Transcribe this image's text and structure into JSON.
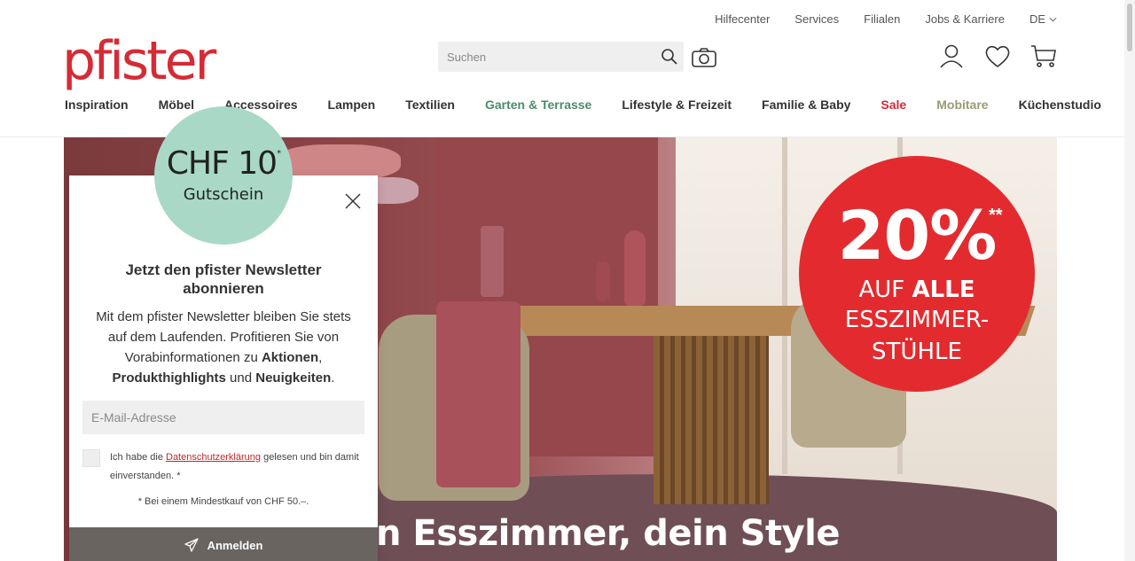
{
  "util_nav": [
    "Hilfecenter",
    "Services",
    "Filialen",
    "Jobs & Karriere"
  ],
  "language": "DE",
  "logo": "pfister",
  "search": {
    "placeholder": "Suchen"
  },
  "main_nav": [
    {
      "label": "Inspiration"
    },
    {
      "label": "Möbel"
    },
    {
      "label": "Accessoires"
    },
    {
      "label": "Lampen"
    },
    {
      "label": "Textilien"
    },
    {
      "label": "Garten & Terrasse",
      "color": "#4a8c6b"
    },
    {
      "label": "Lifestyle & Freizeit"
    },
    {
      "label": "Familie & Baby"
    },
    {
      "label": "Sale",
      "color": "#d52b35"
    },
    {
      "label": "Mobitare",
      "color": "#9a9a74"
    },
    {
      "label": "Küchenstudio"
    }
  ],
  "hero": {
    "headline": "n Esszimmer, dein Style",
    "badge": {
      "percent": "20%",
      "stars": "**",
      "line1_a": "AUF ",
      "line1_b": "ALLE",
      "line2": "ESSZIMMER-",
      "line3": "STÜHLE"
    }
  },
  "newsletter": {
    "voucher_amount": "CHF 10",
    "voucher_sup": "*",
    "voucher_label": "Gutschein",
    "title": "Jetzt den pfister Newsletter abonnieren",
    "desc_1": "Mit dem pfister Newsletter bleiben Sie stets auf dem Laufenden. Profitieren Sie von Vorabinformationen zu ",
    "desc_b1": "Aktionen",
    "desc_2": ", ",
    "desc_b2": "Produkthighlights",
    "desc_3": " und ",
    "desc_b3": "Neuigkeiten",
    "desc_4": ".",
    "email_placeholder": "E-Mail-Adresse",
    "consent_1": "Ich habe die ",
    "consent_link": "Datenschutzerklärung",
    "consent_2": " gelesen und bin damit einverstanden. *",
    "footnote": "* Bei einem Mindestkauf von CHF 50.–.",
    "submit_label": "Anmelden"
  },
  "colors": {
    "brand": "#d52b35",
    "voucher": "#a9d9c6",
    "button": "#6a6461"
  }
}
